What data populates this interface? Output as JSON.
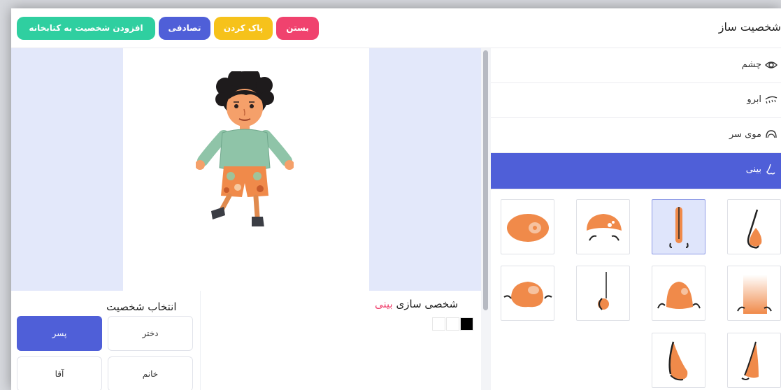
{
  "header": {
    "title": "شخصیت ساز",
    "buttons": {
      "add_to_library": "افزودن شخصیت به کتابخانه",
      "random": "تصادفی",
      "clear": "پاک کردن",
      "close": "بستن"
    }
  },
  "character_select": {
    "title": "انتخاب شخصیت",
    "options": {
      "boy": "پسر",
      "girl": "دختر",
      "man": "آقا",
      "woman": "خانم"
    },
    "selected": "پسر"
  },
  "customize": {
    "prefix": "شخصی سازی",
    "part": "بینی",
    "colors": [
      "#000000",
      "#ffffff",
      "#ffffff"
    ]
  },
  "sidebar": {
    "categories": [
      {
        "label": "چشم",
        "icon": "eye-icon"
      },
      {
        "label": "ابرو",
        "icon": "eyebrow-icon"
      },
      {
        "label": "موی سر",
        "icon": "hair-icon"
      },
      {
        "label": "بینی",
        "icon": "nose-icon",
        "active": true
      }
    ]
  },
  "nose_options": {
    "count": 10,
    "selected_index": 1
  },
  "colors": {
    "accent_blue": "#4f5fd8",
    "add_green": "#2fcfa0",
    "clear_yellow": "#f6c21b",
    "close_pink": "#f0426e",
    "skin": "#f39a57"
  }
}
